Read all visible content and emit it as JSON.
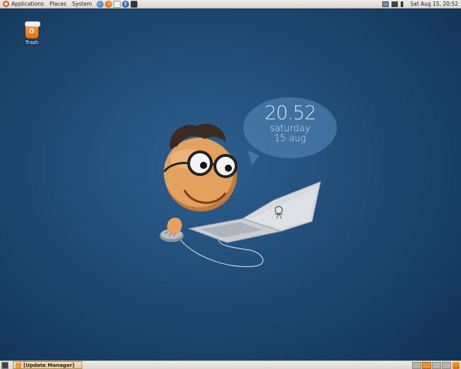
{
  "top_panel": {
    "menus": [
      "Applications",
      "Places",
      "System"
    ],
    "launchers": [
      "web-browser-icon",
      "firefox-icon",
      "mail-icon",
      "help-icon",
      "terminal-icon"
    ],
    "tray_icons": [
      "network-icon",
      "battery-icon",
      "volume-icon"
    ],
    "clock": "Sat Aug 15, 20:52"
  },
  "desktop": {
    "icons": [
      {
        "label": "Trash",
        "icon": "trash-icon"
      }
    ]
  },
  "wallpaper": {
    "time": "20.52",
    "day": "saturday",
    "date": "15 aug"
  },
  "bottom_panel": {
    "task": "[Update Manager]",
    "workspaces": 4,
    "active_workspace": 2
  },
  "colors": {
    "accent": "#e8952e",
    "panel": "#dcd8d0",
    "desktop": "#1f4a74"
  }
}
